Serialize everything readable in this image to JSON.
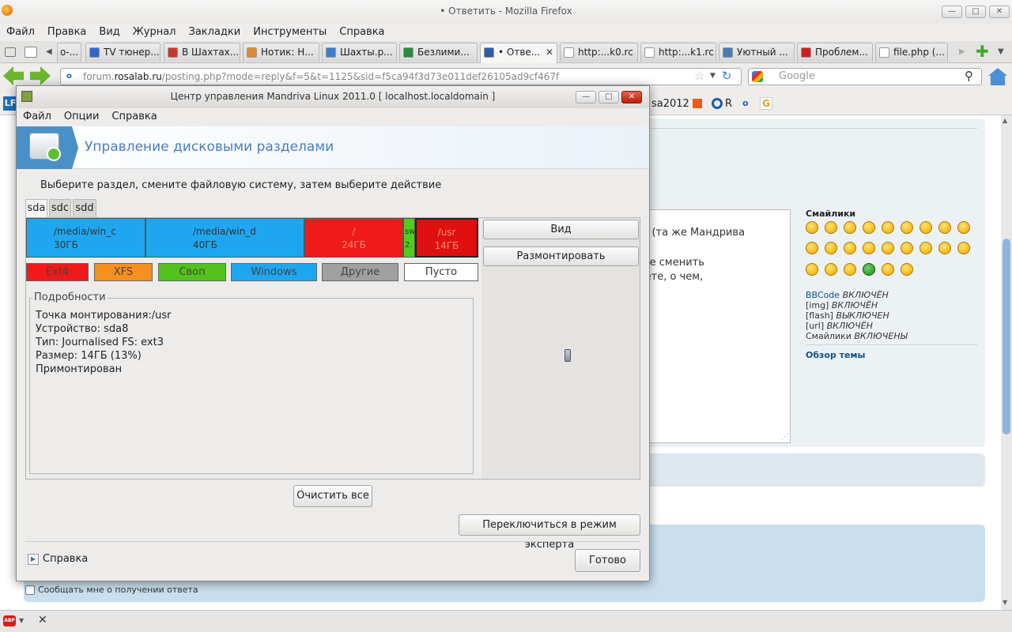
{
  "firefox": {
    "window_title": "• Ответить - Mozilla Firefox",
    "menu": [
      "Файл",
      "Правка",
      "Вид",
      "Журнал",
      "Закладки",
      "Инструменты",
      "Справка"
    ],
    "tabs": [
      {
        "label": "о-...",
        "icon_color": "#ffffff"
      },
      {
        "label": "TV тюнер...",
        "icon_color": "#3366cc"
      },
      {
        "label": "В Шахтах...",
        "icon_color": "#c23a2b"
      },
      {
        "label": "Нотик: Н...",
        "icon_color": "#e08a2b"
      },
      {
        "label": "Шахты.р...",
        "icon_color": "#3c7ccc"
      },
      {
        "label": "Безлими...",
        "icon_color": "#2b8a3e"
      },
      {
        "label": "• Отве...",
        "icon_color": "#2b5ca8"
      },
      {
        "label": "http:...k0.rc",
        "icon_color": "#ffffff"
      },
      {
        "label": "http:...k1.rc",
        "icon_color": "#ffffff"
      },
      {
        "label": "Уютный ...",
        "icon_color": "#4a7ab8"
      },
      {
        "label": "Проблем...",
        "icon_color": "#d0201c"
      },
      {
        "label": "file.php (...",
        "icon_color": "#ffffff"
      }
    ],
    "url_prefix": "forum.",
    "url_domain": "rosalab.ru",
    "url_rest": "/posting.php?mode=reply&f=5&t=1125&sid=f5ca94f3d73e011def26105ad9cf467f",
    "search_placeholder": "Google",
    "bookmarks": [
      "sa2012",
      "R"
    ],
    "bookmark_lf": "LF"
  },
  "forum": {
    "text_line1": "инуксу (та же Мандрива",
    "text_line2": "ак даже сменить",
    "text_line3": "онимаете, о чем,",
    "smilies_title": "Смайлики",
    "bbcode_link": "BBCode",
    "bbcode_state": "ВКЛЮЧЁН",
    "img_label": "[img]",
    "img_state": "ВКЛЮЧЁН",
    "flash_label": "[flash]",
    "flash_state": "ВЫКЛЮЧЕН",
    "url_label": "[url]",
    "url_state": "ВКЛЮЧЁН",
    "smilies_label": "Смайлики",
    "smilies_state": "ВКЛЮЧЕНЫ",
    "topic_review": "Обзор темы",
    "notify_label": "Сообщать мне о получении ответа"
  },
  "dialog": {
    "title": "Центр управления Mandriva Linux 2011.0 [ localhost.localdomain ]",
    "menu": [
      "Файл",
      "Опции",
      "Справка"
    ],
    "banner_title": "Управление дисковыми разделами",
    "instruction": "Выберите раздел, смените файловую систему, затем выберите действие",
    "disk_tabs": [
      "sda",
      "sdc",
      "sdd"
    ],
    "partitions": [
      {
        "mount": "/media/win_c",
        "size": "30ГБ",
        "color": "#1ea7f0"
      },
      {
        "mount": "/media/win_d",
        "size": "40ГБ",
        "color": "#1ea7f0"
      },
      {
        "mount": "/",
        "size": "24ГБ",
        "color": "#f01a1a"
      },
      {
        "mount": "sw",
        "size": "2.",
        "color": "#4fcf1c"
      },
      {
        "mount": "/usr",
        "size": "14ГБ",
        "color": "#e01010"
      }
    ],
    "legend": [
      {
        "label": "Ext4",
        "color": "#f01a1a"
      },
      {
        "label": "XFS",
        "color": "#f6901e"
      },
      {
        "label": "Своп",
        "color": "#54c21c"
      },
      {
        "label": "Windows",
        "color": "#1ea7f0"
      },
      {
        "label": "Другие",
        "color": "#a0a0a0"
      },
      {
        "label": "Пусто",
        "color": "#ffffff"
      }
    ],
    "details_title": "Подробности",
    "details": [
      "Точка монтирования:/usr",
      "Устройство: sda8",
      "Тип: Journalised FS: ext3",
      "Размер: 14ГБ (13%)",
      "Примонтирован"
    ],
    "view_button": "Вид",
    "unmount_button": "Размонтировать",
    "clear_all_button": "Очистить все",
    "expert_button": "Переключиться в режим эксперта",
    "help_label": "Справка",
    "done_button": "Готово"
  }
}
